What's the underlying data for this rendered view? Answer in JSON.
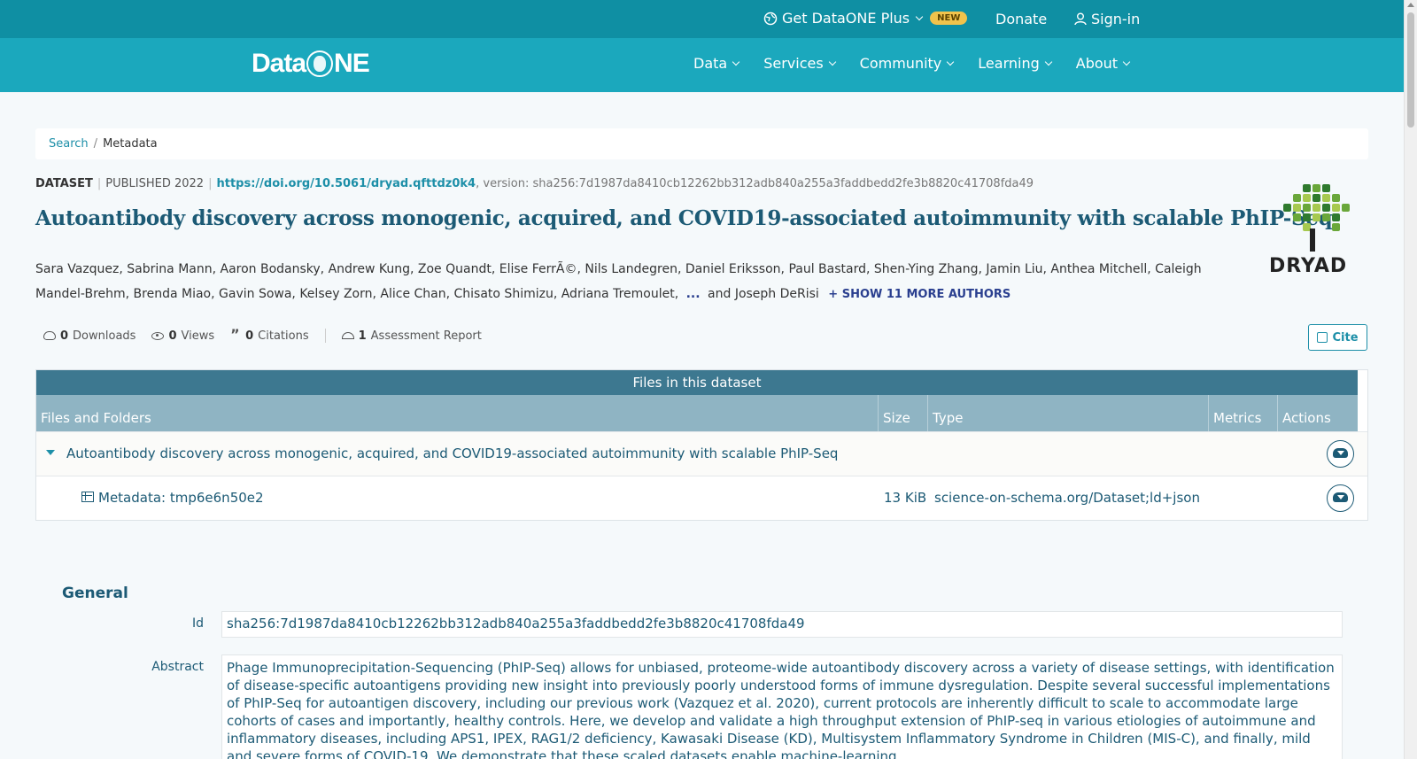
{
  "topbar": {
    "plus_label": "Get DataONE Plus",
    "new_badge": "NEW",
    "donate": "Donate",
    "signin": "Sign-in"
  },
  "navbar": {
    "logo": {
      "text_left": "Data",
      "text_right": "NE"
    },
    "items": [
      {
        "label": "Data"
      },
      {
        "label": "Services"
      },
      {
        "label": "Community"
      },
      {
        "label": "Learning"
      },
      {
        "label": "About"
      }
    ]
  },
  "breadcrumb": {
    "search": "Search",
    "separator": "/",
    "current": "Metadata"
  },
  "dataset": {
    "kind": "DATASET",
    "published": "PUBLISHED 2022",
    "doi": "https://doi.org/10.5061/dryad.qfttdz0k4",
    "version": ", version: sha256:7d1987da8410cb12262bb312adb840a255a3faddbedd2fe3b8820c41708fda49",
    "title": "Autoantibody discovery across monogenic, acquired, and COVID19-associated autoimmunity with scalable PhIP-Seq",
    "authors_line1": "Sara Vazquez, Sabrina Mann, Aaron Bodansky, Andrew Kung, Zoe Quandt, Elise FerrÃ©, Nils Landegren, Daniel Eriksson, Paul Bastard, Shen-Ying Zhang, Jamin Liu, Anthea Mitchell, Caleigh",
    "authors_line2": "Mandel-Brehm, Brenda Miao, Gavin Sowa, Kelsey Zorn, Alice Chan, Chisato Shimizu, Adriana Tremoulet,",
    "ellipsis": "...",
    "last_author": "and Joseph DeRisi",
    "show_more": "+ SHOW 11 MORE AUTHORS",
    "repository_logo": "DRYAD"
  },
  "stats": {
    "downloads_count": "0",
    "downloads_label": "Downloads",
    "views_count": "0",
    "views_label": "Views",
    "citations_count": "0",
    "citations_label": "Citations",
    "assessment_count": "1",
    "assessment_label": "Assessment Report"
  },
  "cite_button": "Cite",
  "files": {
    "heading": "Files in this dataset",
    "columns": [
      "Files and Folders",
      "Size",
      "Type",
      "Metrics",
      "Actions"
    ],
    "folder": {
      "name": "Autoantibody discovery across monogenic, acquired, and COVID19-associated autoimmunity with scalable PhIP-Seq"
    },
    "file": {
      "name": "Metadata: tmp6e6n50e2",
      "size": "13 KiB",
      "type": "science-on-schema.org/Dataset;ld+json"
    }
  },
  "general": {
    "heading": "General",
    "id_label": "Id",
    "id_value": "sha256:7d1987da8410cb12262bb312adb840a255a3faddbedd2fe3b8820c41708fda49",
    "abstract_label": "Abstract",
    "abstract_value": "Phage Immunoprecipitation-Sequencing (PhIP-Seq) allows for unbiased, proteome-wide autoantibody discovery across a variety of disease settings, with identification of disease-specific autoantigens providing new insight into previously poorly understood forms of immune dysregulation. Despite several successful implementations of PhIP-Seq for autoantigen discovery, including our previous work (Vazquez et al. 2020), current protocols are inherently difficult to scale to accommodate large cohorts of cases and importantly, healthy controls. Here, we develop and validate a high throughput extension of PhIP-seq in various etiologies of autoimmune and inflammatory diseases, including APS1, IPEX, RAG1/2 deficiency, Kawasaki Disease (KD), Multisystem Inflammatory Syndrome in Children (MIS-C), and finally, mild and severe forms of COVID-19. We demonstrate that these scaled datasets enable machine-learning"
  },
  "icons": {
    "plus": "globe-icon",
    "signin": "user-icon",
    "downloads": "cloud-download-icon",
    "views": "eye-icon",
    "citations": "quote-icon",
    "assessment": "gauge-icon",
    "cite": "copy-icon",
    "file": "table-icon",
    "download": "cloud-download-icon"
  },
  "colors": {
    "topbar": "#0f8fa3",
    "navbar": "#1ba8bd",
    "title": "#1c5a75",
    "link": "#1d8fa8",
    "files_header": "#3d7890",
    "files_colhead": "#8fb4c3"
  }
}
